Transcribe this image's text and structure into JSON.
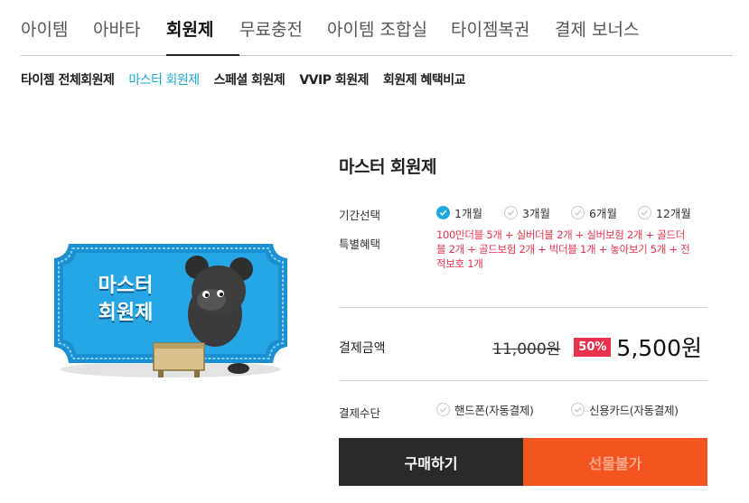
{
  "top_tabs": [
    {
      "label": "아이템"
    },
    {
      "label": "아바타"
    },
    {
      "label": "회원제",
      "active": true
    },
    {
      "label": "무료충전"
    },
    {
      "label": "아이템 조합실"
    },
    {
      "label": "타이젬복권"
    },
    {
      "label": "결제 보너스"
    }
  ],
  "sub_nav": [
    {
      "label": "타이젬 전체회원제"
    },
    {
      "label": "마스터 회원제",
      "active": true
    },
    {
      "label": "스페셜 회원제"
    },
    {
      "label": "VVIP 회원제"
    },
    {
      "label": "회원제 혜택비교"
    }
  ],
  "product": {
    "image_text_line1": "마스터",
    "image_text_line2": "회원제",
    "title": "마스터 회원제",
    "period_label": "기간선택",
    "periods": [
      {
        "label": "1개월",
        "selected": true
      },
      {
        "label": "3개월",
        "selected": false
      },
      {
        "label": "6개월",
        "selected": false
      },
      {
        "label": "12개월",
        "selected": false
      }
    ],
    "bonus_label": "특별혜택",
    "bonus_text": "100만더블 5개 + 실버더블 2개 + 실버보험 2개 + 골드더블 2개 + 골드보험 2개 + 빅더블 1개 + 놓아보기 5개 + 전적보호 1개",
    "payment_label": "결제금액",
    "original_price": "11,000원",
    "discount": "50%",
    "price": "5,500원",
    "method_label": "결제수단",
    "methods": [
      {
        "label": "핸드폰(자동결제)"
      },
      {
        "label": "신용카드(자동결제)"
      }
    ],
    "buy_label": "구매하기",
    "gift_label": "선물불가"
  },
  "colors": {
    "accent_blue": "#1ea7e1",
    "discount_red": "#e6334b",
    "gift_orange": "#f4541f",
    "buy_dark": "#2a2a2a"
  }
}
